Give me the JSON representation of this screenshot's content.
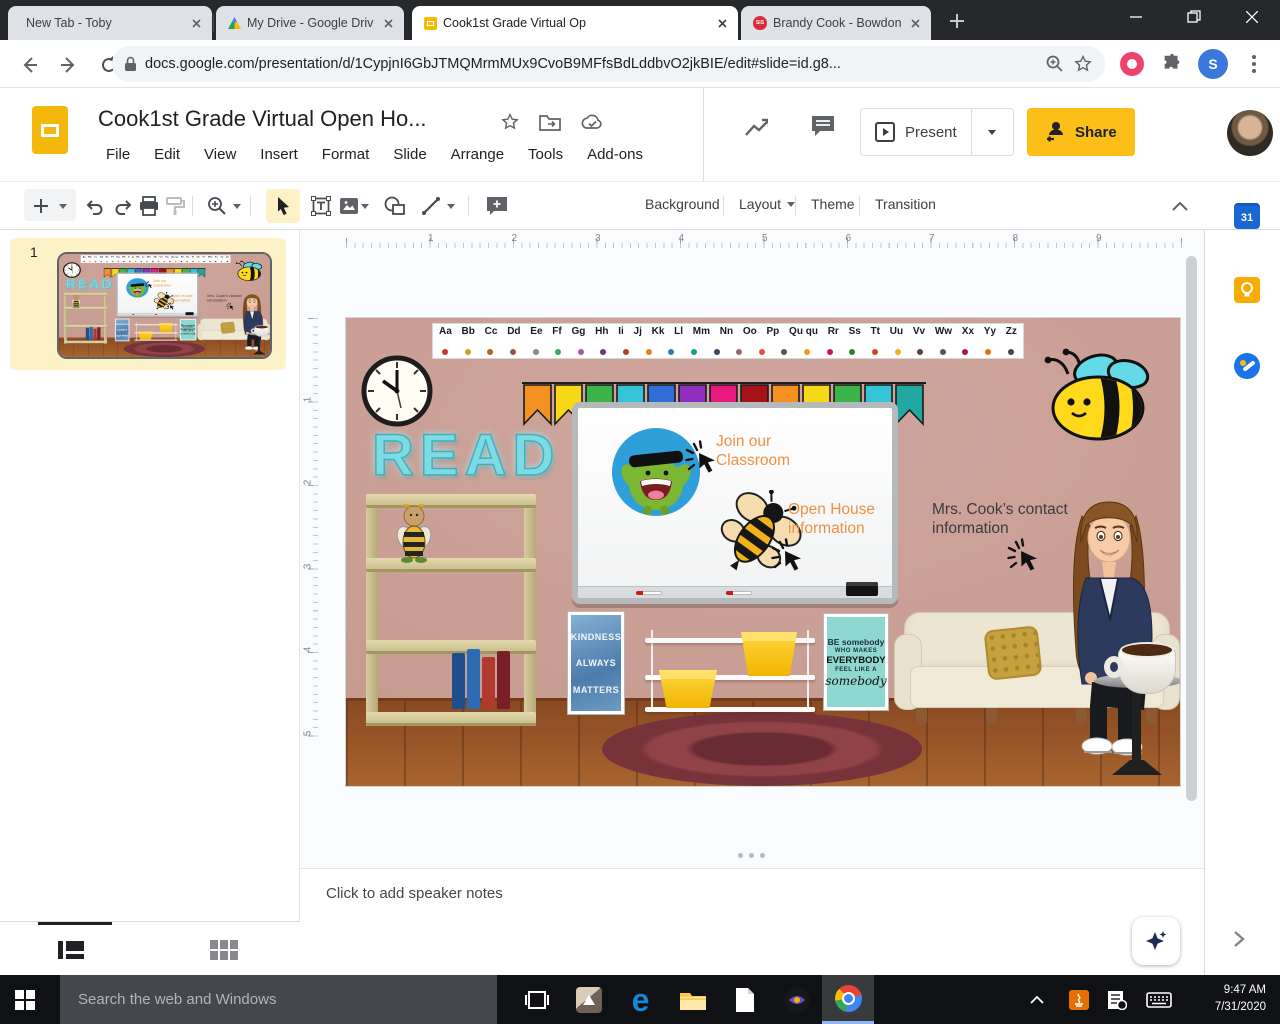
{
  "browser": {
    "tabs": {
      "tab1": {
        "title": "New Tab - Toby"
      },
      "tab2": {
        "title": "My Drive - Google Drive"
      },
      "tab3": {
        "title": "Cook1st Grade Virtual Op"
      },
      "tab4": {
        "title": "Brandy Cook - Bowdon El"
      },
      "sis_badge": "SIS"
    },
    "url": "docs.google.com/presentation/d/1CypjnI6GbJTMQMrmMUx9CvoB9MFfsBdLddbvO2jkBIE/edit#slide=id.g8...",
    "profile_initial": "S"
  },
  "header": {
    "doc_title": "Cook1st Grade Virtual Open Ho...",
    "menus": [
      "File",
      "Edit",
      "View",
      "Insert",
      "Format",
      "Slide",
      "Arrange",
      "Tools",
      "Add-ons"
    ],
    "present_label": "Present",
    "share_label": "Share"
  },
  "toolbar": {
    "background_label": "Background",
    "layout_label": "Layout",
    "theme_label": "Theme",
    "transition_label": "Transition"
  },
  "filmstrip": {
    "slide_number": "1"
  },
  "ruler": {
    "h_numbers": [
      "1",
      "2",
      "3",
      "4",
      "5",
      "6",
      "7",
      "8",
      "9"
    ],
    "v_numbers": [
      "1",
      "2",
      "3",
      "4",
      "5"
    ]
  },
  "slide": {
    "alphabet": [
      "Aa",
      "Bb",
      "Cc",
      "Dd",
      "Ee",
      "Ff",
      "Gg",
      "Hh",
      "Ii",
      "Jj",
      "Kk",
      "Ll",
      "Mm",
      "Nn",
      "Oo",
      "Pp",
      "Qu qu",
      "Rr",
      "Ss",
      "Tt",
      "Uu",
      "Vv",
      "Ww",
      "Xx",
      "Yy",
      "Zz"
    ],
    "alphabet_dot_colors": [
      "#c0392b",
      "#d4a017",
      "#b5651d",
      "#8e5a3c",
      "#7f8c8d",
      "#27ae60",
      "#9b59b6",
      "#6c3483",
      "#c0392b",
      "#e67e22",
      "#2980b9",
      "#16a085",
      "#34495e",
      "#8d6e63",
      "#e74c3c",
      "#6d4c41",
      "#f39c12",
      "#c2185b",
      "#2e7d32",
      "#d84315",
      "#f9a825",
      "#5d4037",
      "#455a64",
      "#ad1457",
      "#ef6c00",
      "#37474f"
    ],
    "flag_colors": [
      "#f59120",
      "#f7d818",
      "#3bb54a",
      "#35c4d7",
      "#2f6fd6",
      "#8e2fc0",
      "#e8197f",
      "#a51318",
      "#f59120",
      "#f7d818",
      "#3bb54a",
      "#35c4d7",
      "#21a8a0"
    ],
    "read_sign": "READ",
    "whiteboard": {
      "join_line1": "Join our",
      "join_line2": "Classroom",
      "open_line1": "Open House",
      "open_line2": "information"
    },
    "contact_line1": "Mrs. Cook’s contact",
    "contact_line2": "information",
    "poster_kindness_lines": [
      "KINDNESS",
      "ALWAYS",
      "MATTERS"
    ],
    "poster_somebody_lines": [
      "BE somebody",
      "WHO MAKES",
      "EVERYBODY",
      "FEEL LIKE A",
      "somebody"
    ]
  },
  "notes": {
    "placeholder": "Click to add speaker notes"
  },
  "side_panel": {
    "calendar_label": "31"
  },
  "taskbar": {
    "search_placeholder": "Search the web and Windows",
    "edge_glyph": "e",
    "time": "9:47 AM",
    "date": "7/31/2020"
  },
  "colors": {
    "share_yellow": "#fcbf17",
    "selection_yellow": "#fdf1c7",
    "link_orange": "#ef9143",
    "slide_wall": "#c79e96"
  }
}
